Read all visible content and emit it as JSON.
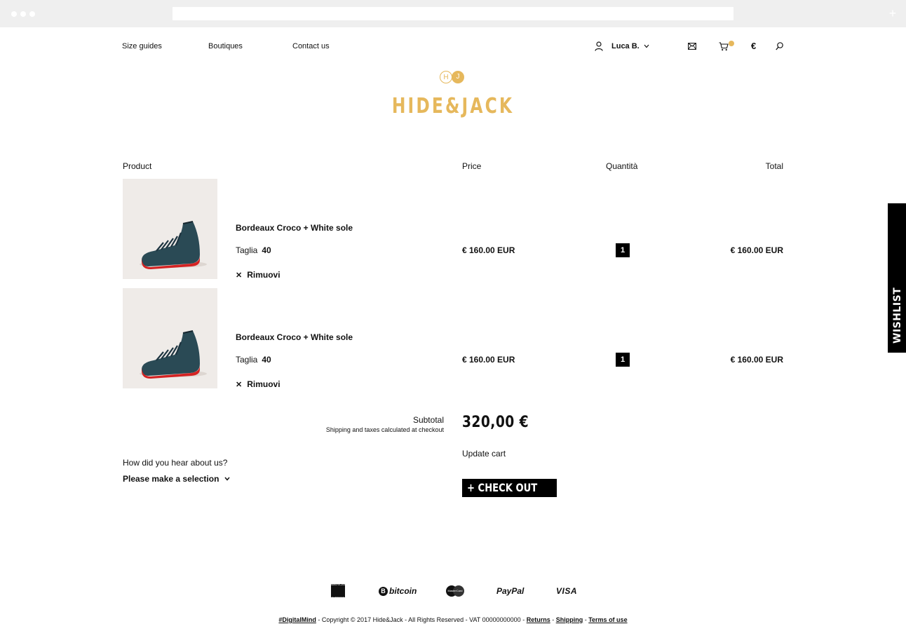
{
  "colors": {
    "accent": "#e6b85c",
    "text": "#111111",
    "chrome": "#efefef",
    "product_bg": "#efebe8",
    "shoe_body": "#2a4a55",
    "shoe_sole": "#d42323"
  },
  "browser": {
    "new_tab_label": "+"
  },
  "header": {
    "nav": [
      "Size guides",
      "Boutiques",
      "Contact us"
    ],
    "user_name": "Luca B.",
    "currency_symbol": "€",
    "icons": [
      "user-icon",
      "chevron-down-icon",
      "mail-icon",
      "cart-icon",
      "search-icon"
    ]
  },
  "logo": {
    "mark_left": "H",
    "mark_right": "J",
    "text": "HIDE&JACK"
  },
  "cart": {
    "columns": {
      "product": "Product",
      "price": "Price",
      "quantity": "Quantità",
      "total": "Total"
    },
    "items": [
      {
        "name": "Bordeaux Croco + White sole",
        "size_label": "Taglia",
        "size": "40",
        "remove_label": "Rimuovi",
        "price": "€ 160.00  EUR",
        "quantity": "1",
        "total": "€ 160.00  EUR"
      },
      {
        "name": "Bordeaux Croco + White sole",
        "size_label": "Taglia",
        "size": "40",
        "remove_label": "Rimuovi",
        "price": "€ 160.00  EUR",
        "quantity": "1",
        "total": "€ 160.00  EUR"
      }
    ],
    "subtotal_label": "Subtotal",
    "shipping_note": "Shipping and taxes calculated at checkout",
    "subtotal_value": "320,00 €",
    "update_cart": "Update cart",
    "checkout": "+ CHECK OUT",
    "hear_about_label": "How did you hear about us?",
    "hear_about_placeholder": "Please make a selection"
  },
  "wishlist": {
    "label": "WISHLIST"
  },
  "footer": {
    "payments": {
      "amex": "AMERICAN EXPRESS",
      "bitcoin_symbol": "B",
      "bitcoin": "bitcoin",
      "mastercard": "MasterCard",
      "paypal": "PayPal",
      "visa": "VISA"
    },
    "copyright": {
      "brand_link": "#DigitalMind",
      "text": " - Copyright © 2017 Hide&Jack - All Rights Reserved - VAT 00000000000 - ",
      "returns": "Returns",
      "sep1": " - ",
      "shipping": "Shipping",
      "sep2": " - ",
      "terms": "Terms of use"
    }
  }
}
